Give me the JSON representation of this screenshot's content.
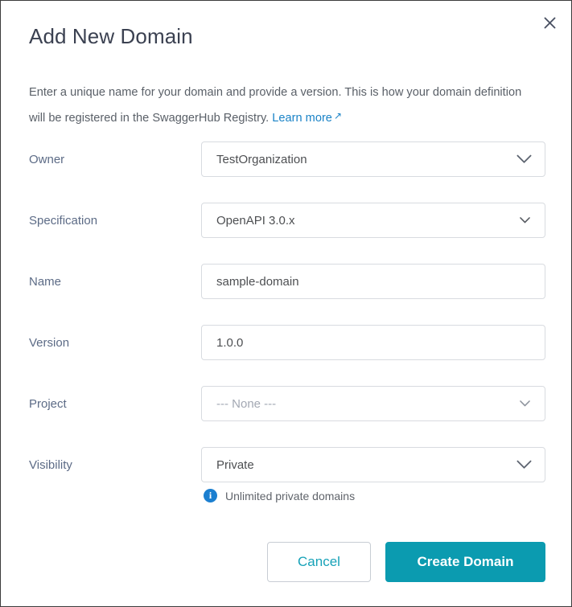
{
  "dialog": {
    "title": "Add New Domain",
    "close_icon": "close-icon",
    "description_part1": "Enter a unique name for your domain and provide a version. This is how your domain definition will be registered in the SwaggerHub Registry.",
    "learn_more_label": "Learn more",
    "learn_more_arrow": "↗"
  },
  "form": {
    "rows": [
      {
        "label": "Owner",
        "value": "TestOrganization",
        "control": "select",
        "chevron": "large",
        "is_placeholder": false
      },
      {
        "label": "Specification",
        "value": "OpenAPI 3.0.x",
        "control": "select",
        "chevron": "small",
        "is_placeholder": false
      },
      {
        "label": "Name",
        "value": "sample-domain",
        "control": "text",
        "chevron": "none",
        "is_placeholder": false
      },
      {
        "label": "Version",
        "value": "1.0.0",
        "control": "text",
        "chevron": "none",
        "is_placeholder": false
      },
      {
        "label": "Project",
        "value": "--- None ---",
        "control": "select",
        "chevron": "small",
        "is_placeholder": true
      },
      {
        "label": "Visibility",
        "value": "Private",
        "control": "select",
        "chevron": "large",
        "is_placeholder": false
      }
    ],
    "visibility_hint": {
      "icon": "info-icon",
      "icon_glyph": "i",
      "text": "Unlimited private domains"
    }
  },
  "footer": {
    "cancel_label": "Cancel",
    "create_label": "Create Domain"
  },
  "colors": {
    "primary_teal": "#0b9bb0",
    "link_blue": "#1a83c7",
    "info_blue": "#1b7fd0",
    "label_slate": "#5c6b86",
    "title_slate": "#3b4151",
    "field_border": "#d8dbe0"
  }
}
